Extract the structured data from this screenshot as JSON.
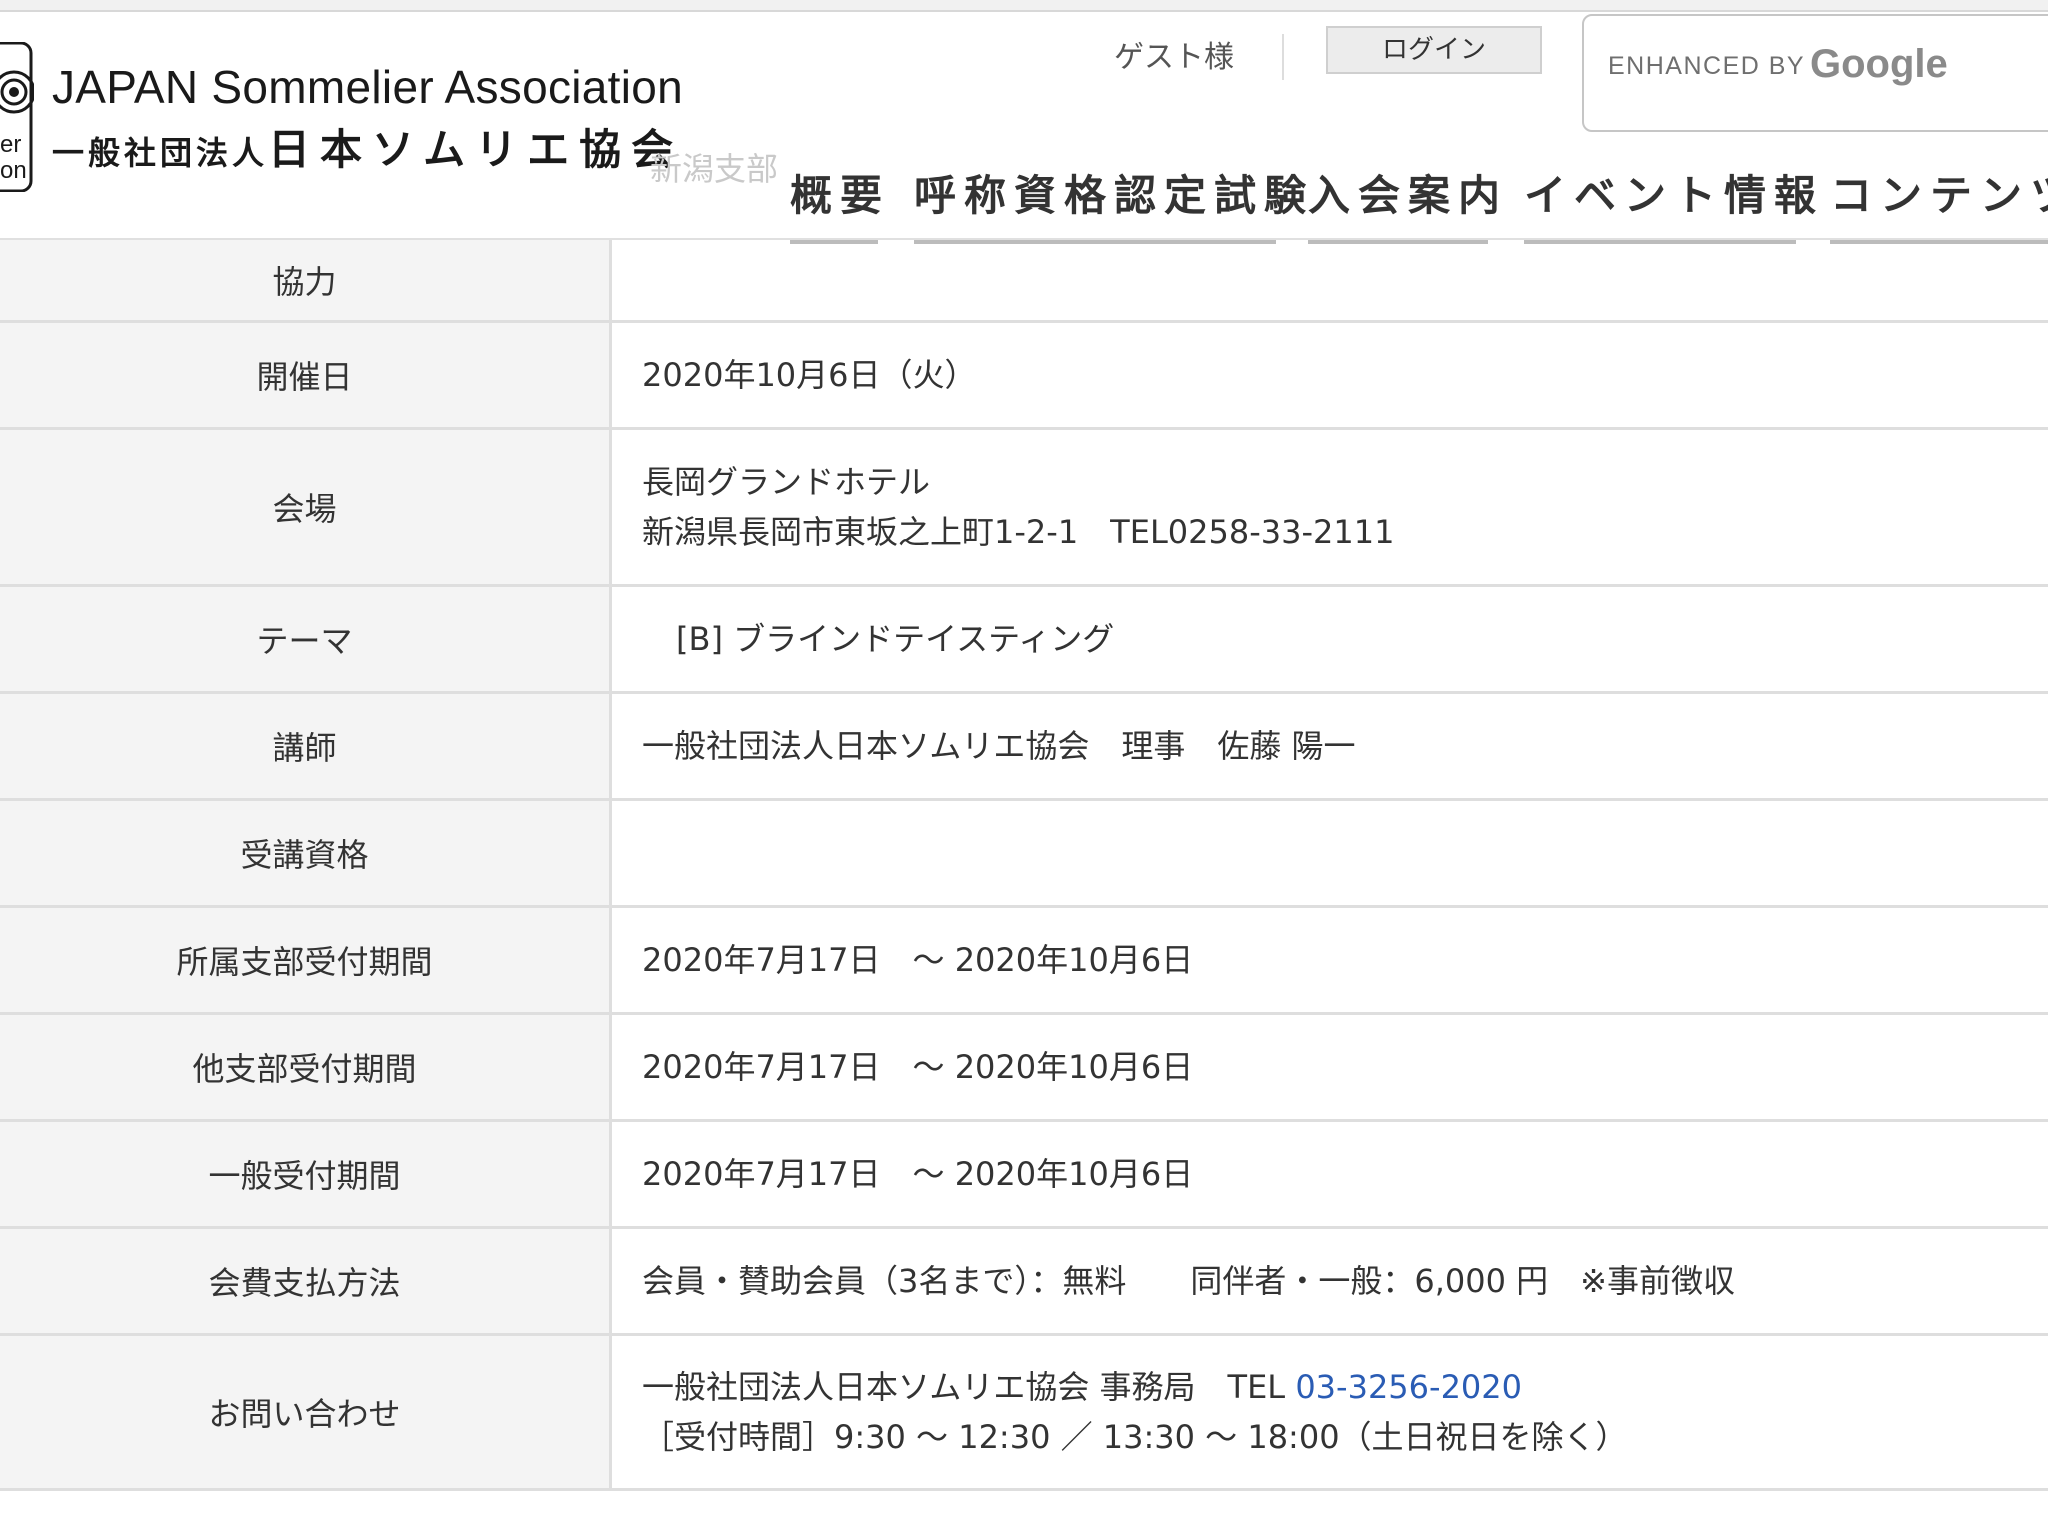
{
  "header": {
    "logo_en": "JAPAN Sommelier Association",
    "logo_jp_prefix": "一般社団法人",
    "logo_jp_name": "日本ソムリエ協会",
    "logo_side_text": [
      "er",
      "on"
    ],
    "branch": "新潟支部",
    "guest": "ゲスト様",
    "login": "ログイン",
    "search": {
      "enhanced_by": "ENHANCED BY",
      "brand": "Google"
    },
    "nav": [
      "概要",
      "呼称資格認定試験",
      "入会案内",
      "イベント情報",
      "コンテンツ"
    ]
  },
  "event": {
    "rows": [
      {
        "label": "協力",
        "lines": []
      },
      {
        "label": "開催日",
        "lines": [
          "2020年10月6日（火）"
        ]
      },
      {
        "label": "会場",
        "lines": [
          "長岡グランドホテル",
          "新潟県長岡市東坂之上町1-2-1　TEL0258-33-2111"
        ]
      },
      {
        "label": "テーマ",
        "lines": [
          "[B] ブラインドテイスティング"
        ]
      },
      {
        "label": "講師",
        "lines": [
          "一般社団法人日本ソムリエ協会　理事　佐藤 陽一"
        ]
      },
      {
        "label": "受講資格",
        "lines": []
      },
      {
        "label": "所属支部受付期間",
        "lines": [
          "2020年7月17日　～ 2020年10月6日"
        ]
      },
      {
        "label": "他支部受付期間",
        "lines": [
          "2020年7月17日　～ 2020年10月6日"
        ]
      },
      {
        "label": "一般受付期間",
        "lines": [
          "2020年7月17日　～ 2020年10月6日"
        ]
      },
      {
        "label": "会費支払方法",
        "lines": [
          "会員・賛助会員（3名まで）：無料　　同伴者・一般：6,000 円　※事前徴収"
        ]
      },
      {
        "label": "お問い合わせ",
        "lines": [
          "一般社団法人日本ソムリエ協会 事務局　TEL ",
          "［受付時間］9:30 ～ 12:30 ／ 13:30 ～ 18:00（土日祝日を除く）"
        ],
        "phone": "03-3256-2020"
      }
    ]
  },
  "colors": {
    "link": "#2a5cb4",
    "label_bg": "#f4f4f4",
    "border": "#dedede"
  }
}
